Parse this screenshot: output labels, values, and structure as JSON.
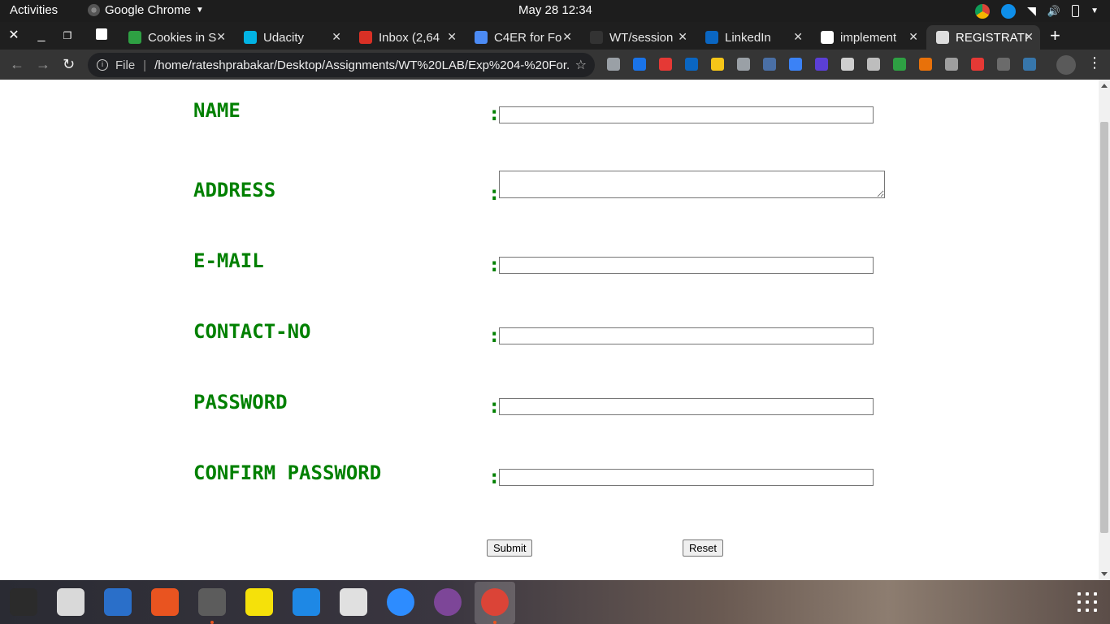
{
  "system_bar": {
    "activities": "Activities",
    "app_name": "Google Chrome",
    "clock": "May 28  12:34"
  },
  "tabs": [
    {
      "label": "Cookies in S",
      "favicon_color": "#2ea043",
      "favicon_icon": "grammarly-icon"
    },
    {
      "label": "Udacity",
      "favicon_color": "#02b3e4",
      "favicon_icon": "udacity-icon"
    },
    {
      "label": "Inbox (2,64",
      "favicon_color": "#d93025",
      "favicon_icon": "gmail-icon"
    },
    {
      "label": "C4ER for Fo",
      "favicon_color": "#4c8bf5",
      "favicon_icon": "link-icon"
    },
    {
      "label": "WT/session",
      "favicon_color": "#333333",
      "favicon_icon": "github-icon"
    },
    {
      "label": "LinkedIn",
      "favicon_color": "#0a66c2",
      "favicon_icon": "linkedin-icon"
    },
    {
      "label": "implement",
      "favicon_color": "#ffffff",
      "favicon_icon": "google-icon"
    },
    {
      "label": "REGISTRATI",
      "favicon_color": "#dddddd",
      "favicon_icon": "globe-icon",
      "active": true
    }
  ],
  "omnibox": {
    "scheme": "File",
    "url": "/home/rateshprabakar/Desktop/Assignments/WT%20LAB/Exp%204-%20For..."
  },
  "form": {
    "fields": [
      {
        "label": "NAME",
        "type": "text",
        "value": ""
      },
      {
        "label": "ADDRESS",
        "type": "textarea",
        "value": ""
      },
      {
        "label": "E-MAIL",
        "type": "text",
        "value": ""
      },
      {
        "label": "CONTACT-NO",
        "type": "text",
        "value": ""
      },
      {
        "label": "PASSWORD",
        "type": "password",
        "value": ""
      },
      {
        "label": "CONFIRM PASSWORD",
        "type": "password",
        "value": ""
      }
    ],
    "colon": ":",
    "submit_label": "Submit",
    "reset_label": "Reset"
  },
  "colors": {
    "label_green": "#008000",
    "chrome_dark": "#1f1f1f",
    "toolbar": "#353535"
  },
  "dock_apps": [
    "terminal-icon",
    "rhythmbox-icon",
    "document-viewer-icon",
    "software-center-icon",
    "file-manager-icon",
    "notes-icon",
    "vscode-icon",
    "document-scanner-icon",
    "zoom-icon",
    "tor-browser-icon",
    "chrome-icon"
  ]
}
